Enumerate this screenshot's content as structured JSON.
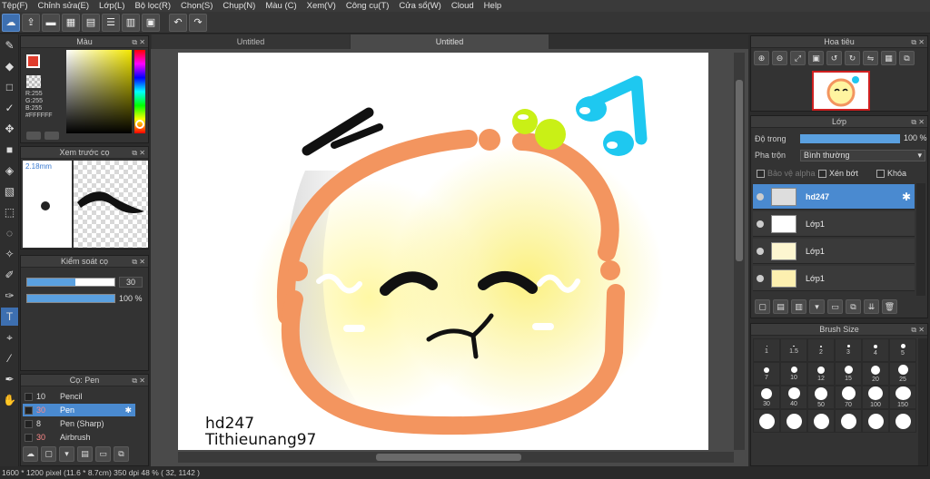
{
  "menu": [
    "Tệp(F)",
    "Chỉnh sửa(E)",
    "Lớp(L)",
    "Bộ lọc(R)",
    "Chọn(S)",
    "Chụp(N)",
    "Màu (C)",
    "Xem(V)",
    "Công cụ(T)",
    "Cửa sổ(W)",
    "Cloud",
    "Help"
  ],
  "panels": {
    "color_title": "Màu",
    "preview_title": "Xem trước cọ",
    "brush_control_title": "Kiểm soát cọ",
    "brush_title": "Cọ: Pen",
    "navigator_title": "Hoa tiêu",
    "layer_title": "Lớp",
    "brush_size_title": "Brush Size"
  },
  "color": {
    "r": "R:255",
    "g": "G:255",
    "b": "B:255",
    "hex": "#FFFFFF",
    "fg": "#e03c2c",
    "bg": "#f08a50"
  },
  "preview": {
    "size": "2.18mm"
  },
  "brush_control": {
    "size_value": "30",
    "size_level": 0.55,
    "opacity_value": "100 %",
    "opacity_level": 1.0
  },
  "brushes": [
    {
      "num": "10",
      "name": "Pencil"
    },
    {
      "num": "30",
      "name": "Pen",
      "selected": true
    },
    {
      "num": "8",
      "name": "Pen (Sharp)"
    },
    {
      "num": "30",
      "name": "Airbrush"
    }
  ],
  "tabs": [
    "Untitled",
    "Untitled"
  ],
  "canvas": {
    "signature_line1": "hd247",
    "signature_line2": "Tithieunang97"
  },
  "layer": {
    "opacity_label": "Độ trong",
    "opacity_value": "100 %",
    "blend_label": "Pha trộn",
    "blend_value": "Bình thường",
    "protect_alpha": "Bảo vệ alpha",
    "clipping": "Xén bớt",
    "lock": "Khóa",
    "items": [
      {
        "name": "hd247",
        "selected": true
      },
      {
        "name": "Lớp1"
      },
      {
        "name": "Lớp1"
      },
      {
        "name": "Lớp1"
      }
    ]
  },
  "brush_sizes": [
    "1",
    "1.5",
    "2",
    "3",
    "4",
    "5",
    "7",
    "10",
    "12",
    "15",
    "20",
    "25",
    "30",
    "40",
    "50",
    "70",
    "100",
    "150",
    "",
    "",
    "",
    "",
    "",
    ""
  ],
  "status": "1600 * 1200 pixel   (11.6 * 8.7cm)   350 dpi   48 %   ( 32, 1142 )"
}
